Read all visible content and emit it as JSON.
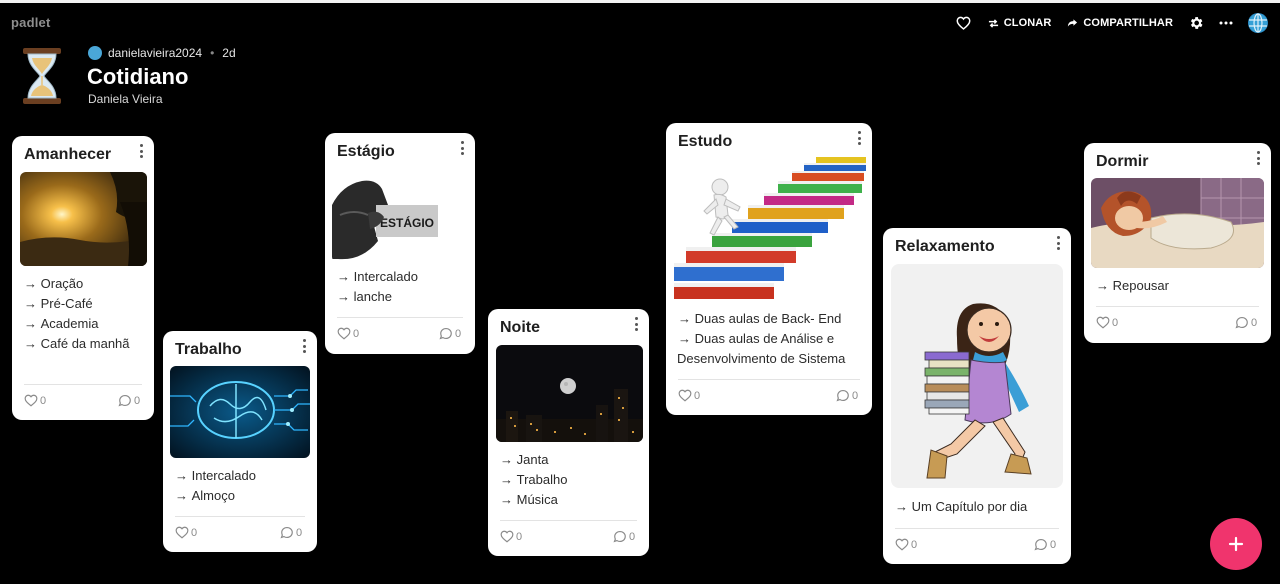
{
  "brand": "padlet",
  "toolbar": {
    "clone_label": "CLONAR",
    "share_label": "COMPARTILHAR"
  },
  "board": {
    "author": "danielavieira2024",
    "age": "2d",
    "title": "Cotidiano",
    "subtitle": "Daniela Vieira"
  },
  "cards": [
    {
      "title": "Amanhecer",
      "items": [
        "Oração",
        "Pré-Café",
        "Academia",
        "Café da manhã"
      ],
      "likes": "0",
      "comments": "0"
    },
    {
      "title": "Trabalho",
      "items": [
        "Intercalado",
        "Almoço"
      ],
      "likes": "0",
      "comments": "0"
    },
    {
      "title": "Estágio",
      "image_text": "ESTÁGIO",
      "items": [
        "Intercalado",
        "lanche"
      ],
      "likes": "0",
      "comments": "0"
    },
    {
      "title": "Noite",
      "items": [
        "Janta",
        "Trabalho",
        "Música"
      ],
      "likes": "0",
      "comments": "0"
    },
    {
      "title": "Estudo",
      "items": [
        "Duas aulas de Back- End",
        "Duas aulas de Análise e"
      ],
      "item_continuation": "Desenvolvimento de Sistema",
      "likes": "0",
      "comments": "0"
    },
    {
      "title": "Relaxamento",
      "items": [
        "Um Capítulo por dia"
      ],
      "likes": "0",
      "comments": "0"
    },
    {
      "title": "Dormir",
      "items": [
        "Repousar"
      ],
      "likes": "0",
      "comments": "0"
    }
  ],
  "colors": {
    "background": "#000000",
    "card": "#ffffff",
    "accent_fab": "#f0346d"
  },
  "icons": [
    "heart-icon",
    "clone-icon",
    "share-icon",
    "gear-icon",
    "more-icon",
    "globe-icon",
    "hourglass-icon",
    "kebab-icon",
    "comment-icon",
    "plus-icon"
  ]
}
